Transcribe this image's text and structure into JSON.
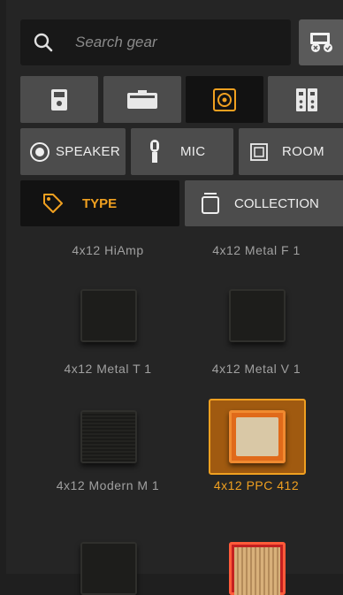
{
  "search": {
    "placeholder": "Search gear"
  },
  "categories": [
    {
      "name": "stompbox",
      "active": false
    },
    {
      "name": "amp",
      "active": false
    },
    {
      "name": "cabinet",
      "active": true
    },
    {
      "name": "rack",
      "active": false
    }
  ],
  "sub_tabs": {
    "speaker": "SPEAKER",
    "mic": "MIC",
    "room": "ROOM"
  },
  "sort": {
    "type": "TYPE",
    "collection": "COLLECTION"
  },
  "colors": {
    "accent": "#f0a020",
    "selected_bg": "#a05a10"
  },
  "gear_list": [
    {
      "label": "4x12 HiAmp",
      "selected": false
    },
    {
      "label": "4x12 Metal F 1",
      "selected": false
    },
    {
      "label": "4x12 Metal T 1",
      "selected": false
    },
    {
      "label": "4x12 Metal V 1",
      "selected": false
    },
    {
      "label": "4x12 Modern M 1",
      "selected": false
    },
    {
      "label": "4x12 PPC 412",
      "selected": true
    }
  ]
}
